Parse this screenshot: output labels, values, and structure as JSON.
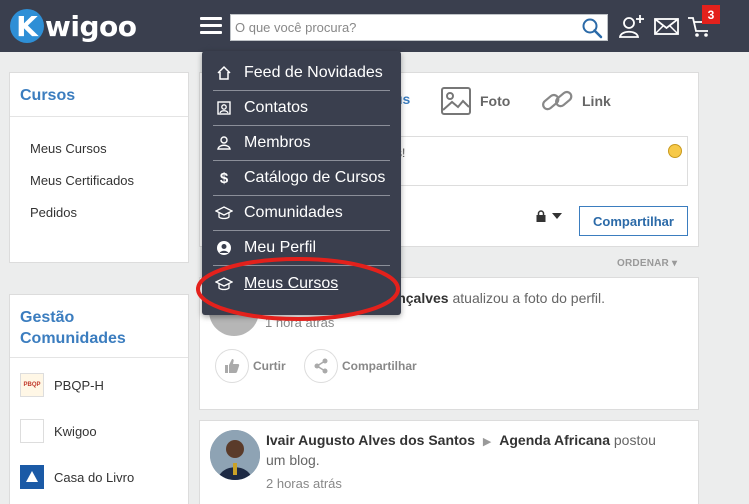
{
  "header": {
    "logo_k": "K",
    "logo_text": "wigoo",
    "search_placeholder": "O que você procura?",
    "cart_badge": "3"
  },
  "menu": {
    "items": [
      {
        "label": "Feed de Novidades",
        "icon": "home-icon"
      },
      {
        "label": "Contatos",
        "icon": "contacts-icon"
      },
      {
        "label": "Membros",
        "icon": "members-icon"
      },
      {
        "label": "Catálogo de Cursos",
        "icon": "dollar-icon"
      },
      {
        "label": "Comunidades",
        "icon": "graduation-cap-icon"
      },
      {
        "label": "Meu Perfil",
        "icon": "user-circle-icon"
      },
      {
        "label": "Meus Cursos",
        "icon": "graduation-cap-icon"
      }
    ]
  },
  "sidebar": {
    "cursos_title": "Cursos",
    "cursos_items": [
      "Meus Cursos",
      "Meus Certificados",
      "Pedidos"
    ],
    "gestao_title_line1": "Gestão",
    "gestao_title_line2": "Comunidades",
    "communities": [
      {
        "name": "PBQP-H",
        "thumb": "PBQP"
      },
      {
        "name": "Kwigoo",
        "thumb": ""
      },
      {
        "name": "Casa do Livro",
        "thumb": ""
      }
    ]
  },
  "composer": {
    "tab_partial": "us",
    "tab_foto": "Foto",
    "tab_link": "Link",
    "status_partial": "s!",
    "share_label": "Compartilhar"
  },
  "feed": {
    "sort_label": "ORDENAR",
    "post1": {
      "author_partial": "i Gonçalves",
      "action_text": " atualizou a foto do perfil.",
      "time": "1 hora atrás",
      "like_label": "Curtir",
      "share_label": "Compartilhar"
    },
    "post2": {
      "author": "Ivair Augusto Alves dos Santos",
      "target": "Agenda Africana",
      "action_text_1": " postou",
      "action_text_2": "um blog.",
      "time": "2 horas atrás"
    }
  },
  "colors": {
    "topbar": "#3a3f4e",
    "accent": "#3b7dbf",
    "highlight_circle": "#e3211c"
  }
}
